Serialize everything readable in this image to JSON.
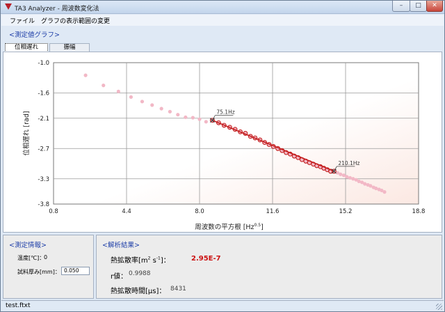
{
  "window": {
    "title": "TA3 Analyzer - 周波数変化法",
    "min_glyph": "–",
    "max_glyph": "□",
    "close_glyph": "✕"
  },
  "menu": [
    {
      "label": "ファイル"
    },
    {
      "label": "グラフの表示範囲の変更"
    }
  ],
  "graph_section": {
    "title": "<測定値グラフ>"
  },
  "tabs": [
    {
      "label": "位相遅れ",
      "active": true
    },
    {
      "label": "振幅",
      "active": false
    }
  ],
  "chart_data": {
    "type": "scatter",
    "xlabel": "周波数の平方根 [Hz",
    "xlabel_sup": "0.5",
    "xlabel_close": "]",
    "ylabel": "位相遅れ [rad]",
    "xlim": [
      0.8,
      18.8
    ],
    "ylim": [
      -3.8,
      -1.0
    ],
    "x_ticks": [
      0.8,
      4.4,
      8.0,
      11.6,
      15.2,
      18.8
    ],
    "x_tick_labels": [
      "0.8",
      "4.4",
      "8.0",
      "11.6",
      "15.2",
      "18.8"
    ],
    "y_ticks": [
      -1.0,
      -1.6,
      -2.1,
      -2.7,
      -3.3,
      -3.8
    ],
    "y_tick_labels": [
      "-1.0",
      "-1.6",
      "-2.1",
      "-2.7",
      "-3.3",
      "-3.8"
    ],
    "grid": true,
    "colors": {
      "all_points": "#f2b8c6",
      "selected_points": "#c42121",
      "fit_line": "#c42121",
      "marker_line": "#444444"
    },
    "series": [
      {
        "x": [
          2.38,
          3.26,
          4.0,
          4.62,
          5.17,
          5.66,
          6.12,
          6.54,
          6.93,
          7.31,
          7.67,
          8.0,
          8.32,
          8.63,
          8.94,
          9.21,
          9.49,
          9.75,
          10.01,
          10.26,
          10.51,
          10.74,
          10.98,
          11.21,
          11.43,
          11.64,
          11.86,
          12.07,
          12.27,
          12.47,
          12.67,
          12.86,
          13.05,
          13.24,
          13.42,
          13.61,
          13.78,
          13.96,
          14.13,
          14.3,
          14.46,
          14.63,
          14.8,
          14.95,
          15.11,
          15.26,
          15.42,
          15.57,
          15.72,
          15.86,
          16.01,
          16.15,
          16.3,
          16.43,
          16.58,
          16.7,
          16.85,
          16.98,
          17.12
        ],
        "y": [
          -1.25,
          -1.45,
          -1.57,
          -1.68,
          -1.77,
          -1.84,
          -1.91,
          -1.97,
          -2.03,
          -2.08,
          -2.09,
          -2.12,
          -2.17,
          -2.14,
          -2.19,
          -2.24,
          -2.28,
          -2.32,
          -2.37,
          -2.4,
          -2.46,
          -2.49,
          -2.53,
          -2.58,
          -2.62,
          -2.66,
          -2.7,
          -2.74,
          -2.78,
          -2.81,
          -2.85,
          -2.88,
          -2.92,
          -2.95,
          -2.98,
          -3.01,
          -3.04,
          -3.06,
          -3.09,
          -3.12,
          -3.15,
          -3.15,
          -3.18,
          -3.21,
          -3.23,
          -3.26,
          -3.28,
          -3.3,
          -3.32,
          -3.35,
          -3.37,
          -3.4,
          -3.42,
          -3.44,
          -3.47,
          -3.49,
          -3.51,
          -3.53,
          -3.56
        ]
      },
      {
        "x": [
          8.63,
          8.94,
          9.21,
          9.49,
          9.75,
          10.01,
          10.26,
          10.51,
          10.74,
          10.98,
          11.21,
          11.43,
          11.64,
          11.86,
          12.07,
          12.27,
          12.47,
          12.67,
          12.86,
          13.05,
          13.24,
          13.42,
          13.61,
          13.78,
          13.96,
          14.13,
          14.3,
          14.46,
          14.63
        ],
        "y": [
          -2.14,
          -2.19,
          -2.24,
          -2.28,
          -2.32,
          -2.37,
          -2.4,
          -2.46,
          -2.49,
          -2.53,
          -2.58,
          -2.62,
          -2.66,
          -2.7,
          -2.74,
          -2.78,
          -2.81,
          -2.85,
          -2.88,
          -2.92,
          -2.95,
          -2.98,
          -3.01,
          -3.04,
          -3.06,
          -3.09,
          -3.12,
          -3.15,
          -3.15
        ]
      }
    ],
    "fit_line": {
      "x": [
        8.63,
        14.63
      ],
      "y": [
        -2.14,
        -3.15
      ]
    },
    "annotations": [
      {
        "text": "75.1Hz",
        "x": 8.63,
        "y": -2.14
      },
      {
        "text": "210.1Hz",
        "x": 14.63,
        "y": -3.15
      }
    ]
  },
  "info_section": {
    "title": "<測定情報>",
    "temperature_label": "温度[℃]：",
    "temperature_value": "0",
    "thickness_label": "試料厚み[mm]：",
    "thickness_value": "0.050"
  },
  "result_section": {
    "title": "<解析結果>",
    "diffusivity_label": "熱拡散率[m",
    "diffusivity_unit_sup1": "2",
    "diffusivity_unit_mid": " s",
    "diffusivity_unit_sup2": "-1",
    "diffusivity_unit_end": "]：",
    "diffusivity_value": "2.95E-7",
    "diffusivity_color": "#cc1111",
    "r_label": "r値：",
    "r_value": "0.9988",
    "time_label": "熱拡散時間[μs]：",
    "time_value": "8431"
  },
  "status": {
    "file": "test.ftxt"
  }
}
